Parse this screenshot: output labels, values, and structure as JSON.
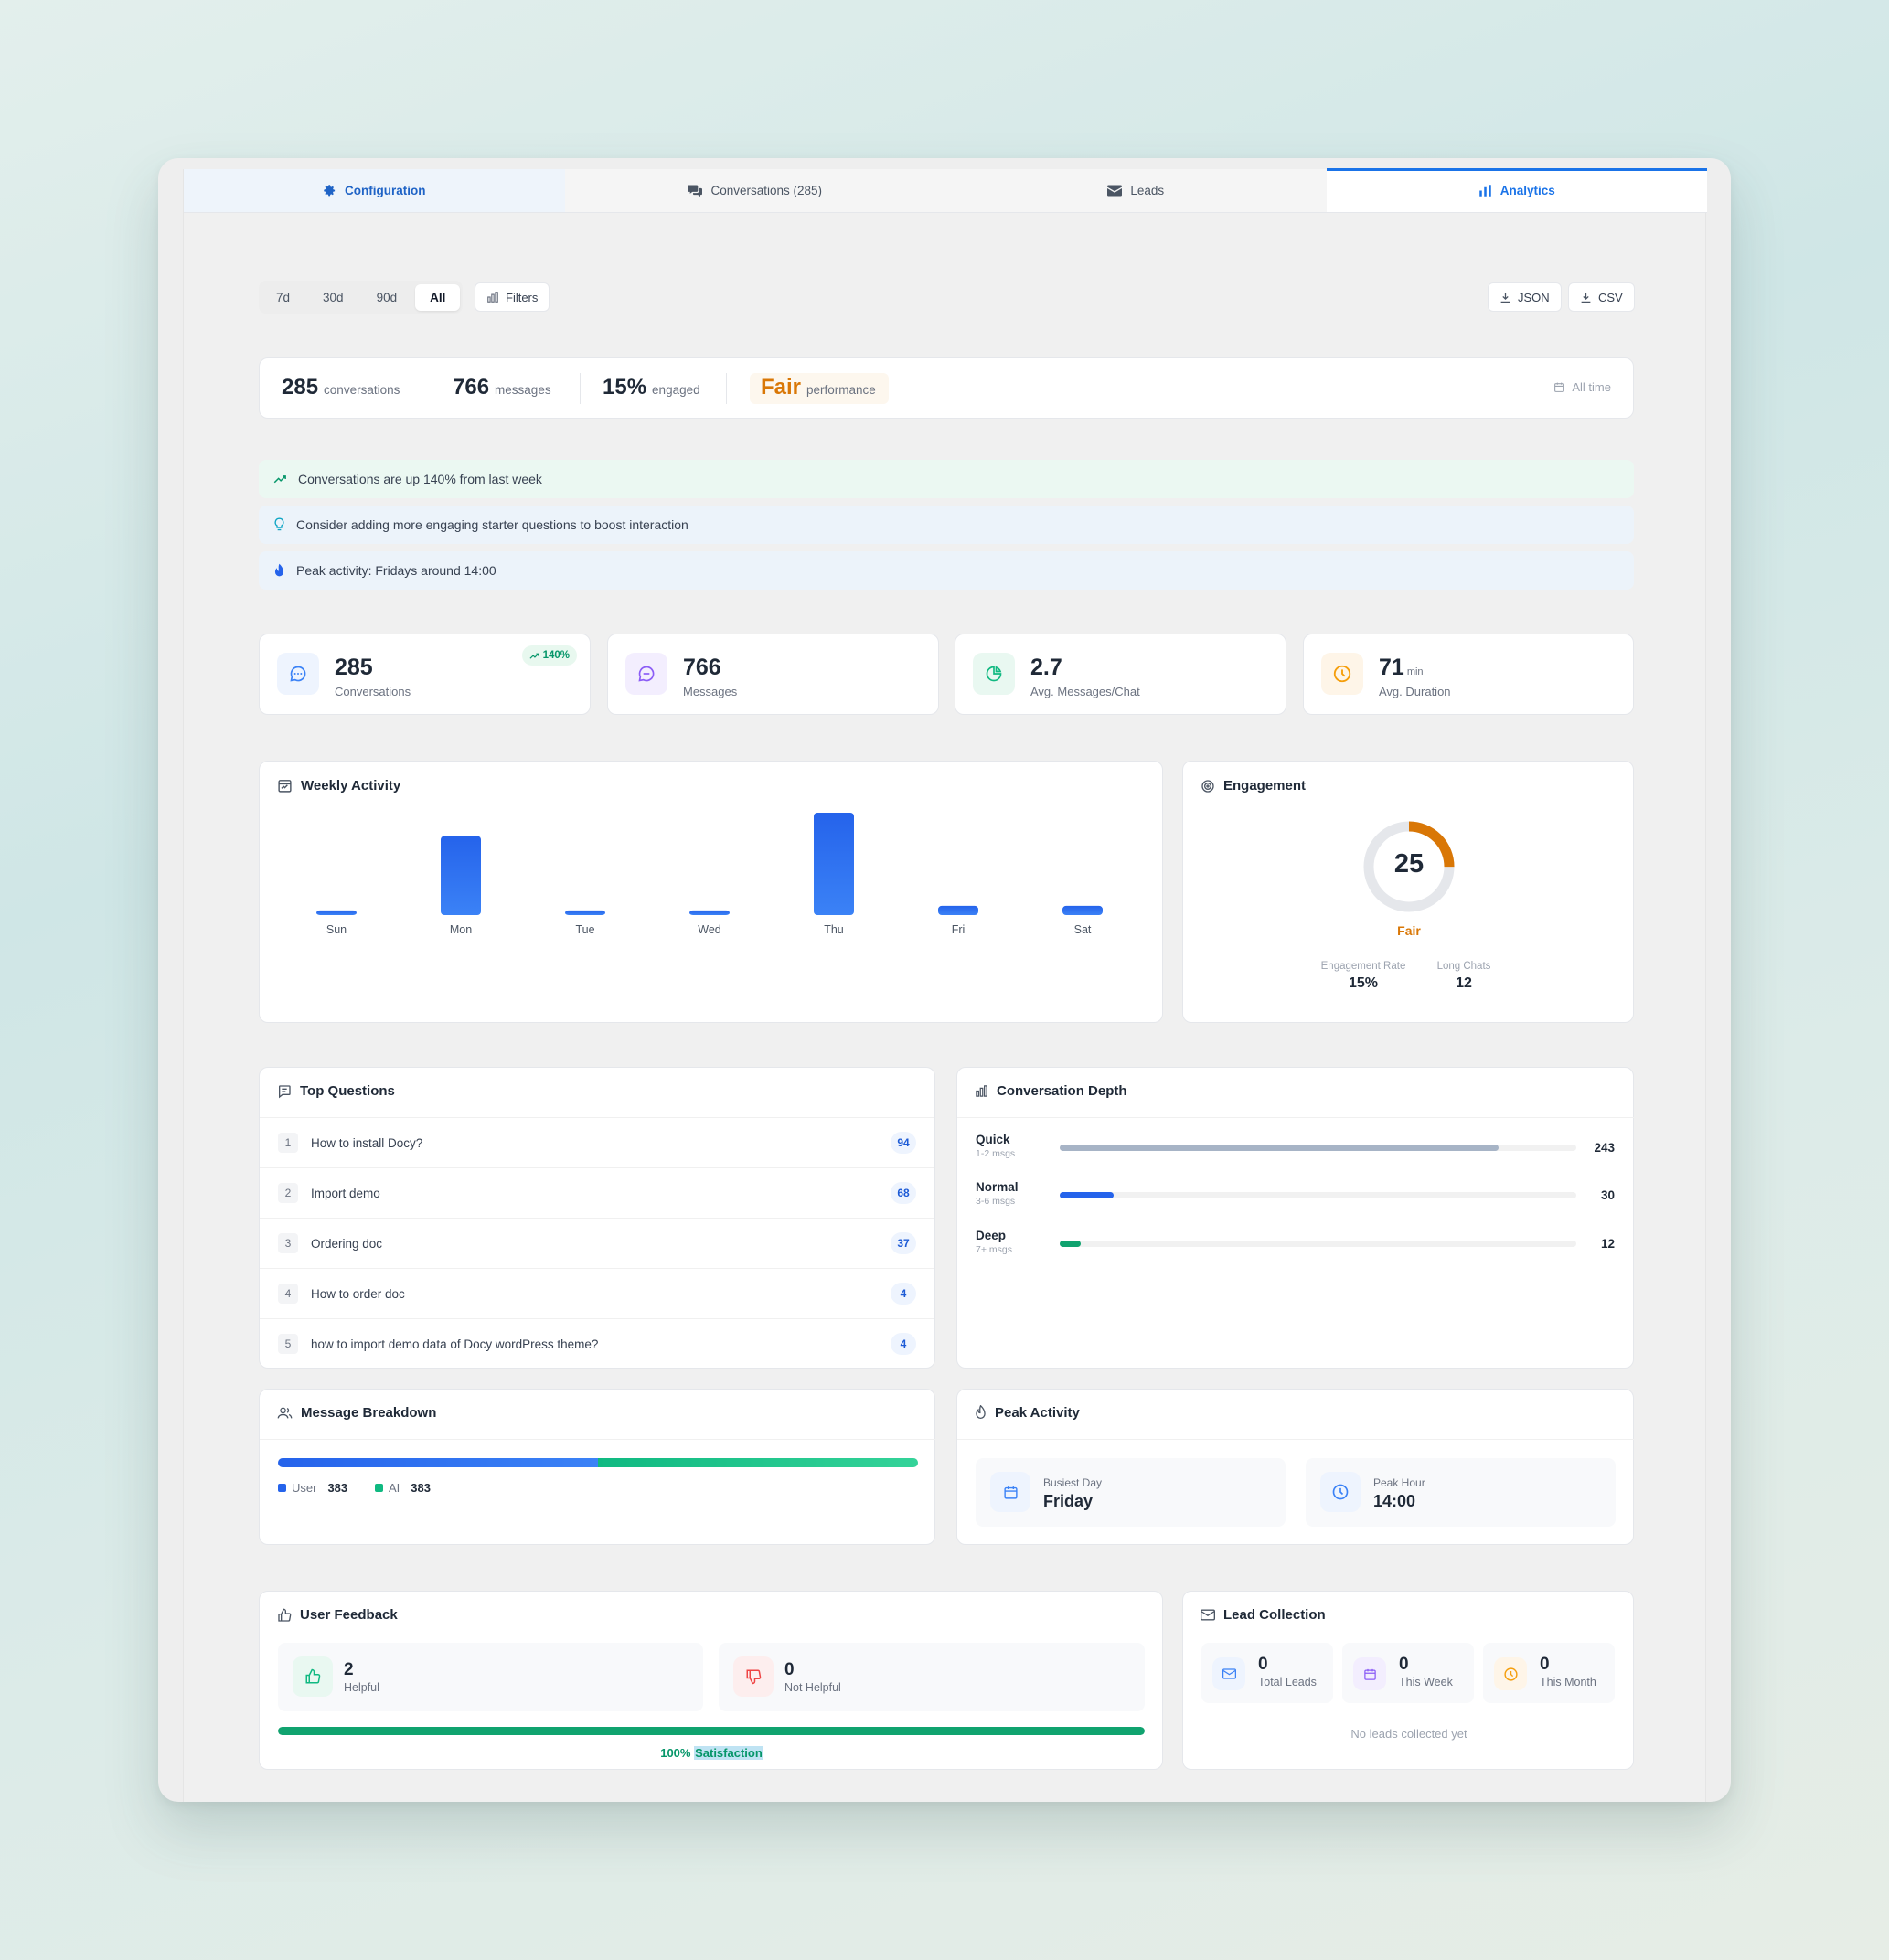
{
  "tabs": [
    {
      "label": "Configuration",
      "icon": "gear-icon"
    },
    {
      "label": "Conversations (285)",
      "icon": "chat-bubbles-icon"
    },
    {
      "label": "Leads",
      "icon": "envelope-icon"
    },
    {
      "label": "Analytics",
      "icon": "bar-chart-icon"
    }
  ],
  "range": {
    "options": [
      "7d",
      "30d",
      "90d",
      "All"
    ],
    "selected": "All",
    "filters_label": "Filters"
  },
  "export": {
    "json_label": "JSON",
    "csv_label": "CSV"
  },
  "summary": {
    "conversations": "285",
    "conversations_label": "conversations",
    "messages": "766",
    "messages_label": "messages",
    "engaged": "15%",
    "engaged_label": "engaged",
    "performance": "Fair",
    "performance_label": "performance",
    "period": "All time"
  },
  "insights": [
    {
      "text": "Conversations are up 140% from last week",
      "icon": "trending-up-icon",
      "bg": "#ebf8f2"
    },
    {
      "text": "Consider adding more engaging starter questions to boost interaction",
      "icon": "lightbulb-icon",
      "bg": "#ecf3fa"
    },
    {
      "text": "Peak activity: Fridays around 14:00",
      "icon": "flame-icon",
      "bg": "#ecf3fa"
    }
  ],
  "stats": [
    {
      "value": "285",
      "label": "Conversations",
      "badge": "140%",
      "icon": "chat-icon",
      "color": "#3b82f6"
    },
    {
      "value": "766",
      "label": "Messages",
      "icon": "message-icon",
      "color": "#8b5cf6"
    },
    {
      "value": "2.7",
      "label": "Avg. Messages/Chat",
      "icon": "pie-chart-icon",
      "color": "#10b981"
    },
    {
      "value": "71",
      "unit": "min",
      "label": "Avg. Duration",
      "icon": "clock-icon",
      "color": "#f59e0b"
    }
  ],
  "weekly": {
    "title": "Weekly Activity",
    "chart_data": {
      "type": "bar",
      "categories": [
        "Sun",
        "Mon",
        "Tue",
        "Wed",
        "Thu",
        "Fri",
        "Sat"
      ],
      "values": [
        1,
        17,
        1,
        1,
        22,
        2,
        2
      ],
      "title": "",
      "xlabel": "",
      "ylabel": ""
    }
  },
  "engagement": {
    "title": "Engagement",
    "score": "25",
    "score_value": 25,
    "rating": "Fair",
    "rate_label": "Engagement Rate",
    "rate": "15%",
    "long_label": "Long Chats",
    "long": "12",
    "accent": "#d97706"
  },
  "top_questions": {
    "title": "Top Questions",
    "items": [
      {
        "rank": "1",
        "text": "How to install Docy?",
        "count": "94"
      },
      {
        "rank": "2",
        "text": "Import demo",
        "count": "68"
      },
      {
        "rank": "3",
        "text": "Ordering doc",
        "count": "37"
      },
      {
        "rank": "4",
        "text": "How to order doc",
        "count": "4"
      },
      {
        "rank": "5",
        "text": "how to import demo data of Docy wordPress theme?",
        "count": "4"
      }
    ]
  },
  "depth": {
    "title": "Conversation Depth",
    "rows": [
      {
        "label": "Quick",
        "sub": "1-2 msgs",
        "value": "243",
        "fraction": 0.85,
        "color": "#a7b4c6"
      },
      {
        "label": "Normal",
        "sub": "3-6 msgs",
        "value": "30",
        "fraction": 0.105,
        "color": "#2563eb"
      },
      {
        "label": "Deep",
        "sub": "7+ msgs",
        "value": "12",
        "fraction": 0.04,
        "color": "#10a36f"
      }
    ]
  },
  "breakdown": {
    "title": "Message Breakdown",
    "user_label": "User",
    "user": "383",
    "ai_label": "AI",
    "ai": "383",
    "user_fraction": 0.5
  },
  "peak": {
    "title": "Peak Activity",
    "day_label": "Busiest Day",
    "day": "Friday",
    "hour_label": "Peak Hour",
    "hour": "14:00"
  },
  "feedback": {
    "title": "User Feedback",
    "helpful": "2",
    "helpful_label": "Helpful",
    "not_helpful": "0",
    "not_helpful_label": "Not Helpful",
    "satisfaction_fraction": 1.0,
    "satisfaction_pct": "100%",
    "satisfaction_label": "Satisfaction"
  },
  "leads": {
    "title": "Lead Collection",
    "total": "0",
    "total_label": "Total Leads",
    "week": "0",
    "week_label": "This Week",
    "month": "0",
    "month_label": "This Month",
    "empty": "No leads collected yet"
  }
}
